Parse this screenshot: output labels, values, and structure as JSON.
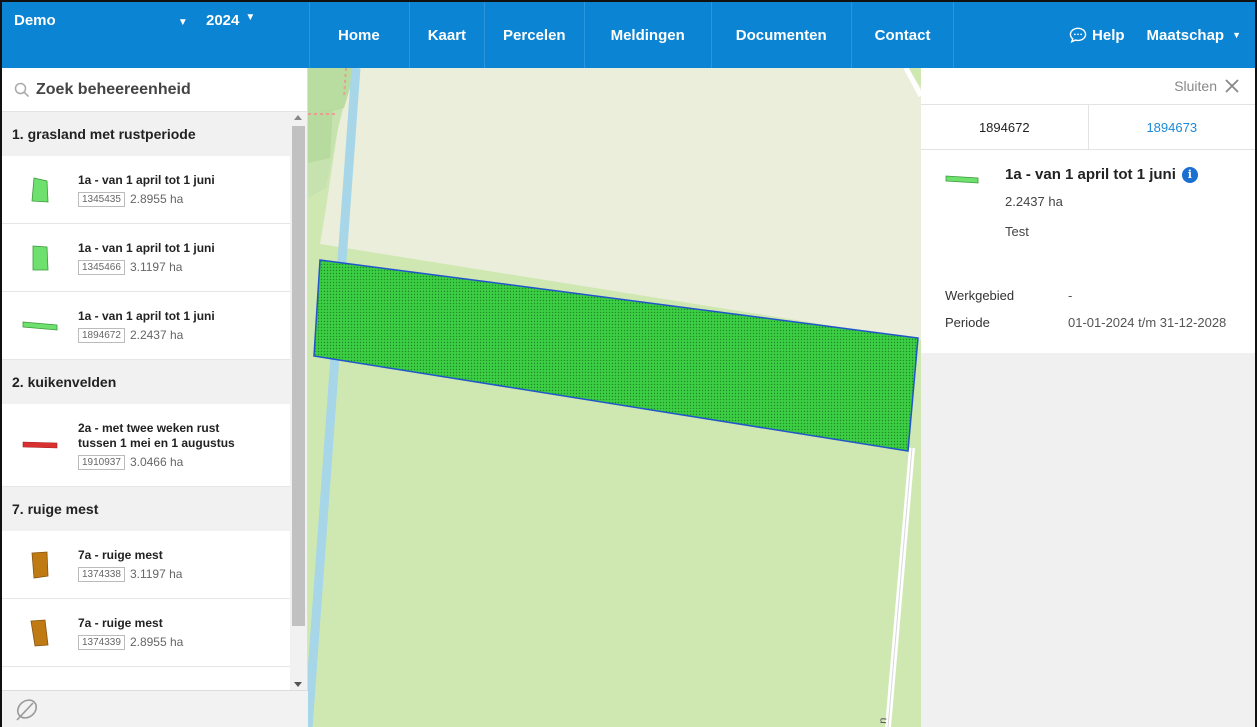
{
  "topbar": {
    "org": "Demo",
    "year": "2024",
    "nav": [
      "Home",
      "Kaart",
      "Percelen",
      "Meldingen",
      "Documenten",
      "Contact"
    ],
    "help": "Help",
    "account": "Maatschap"
  },
  "search": {
    "placeholder": "Zoek beheereenheid"
  },
  "groups": [
    {
      "title": "1. grasland met rustperiode",
      "items": [
        {
          "label": "1a - van 1 april tot 1 juni",
          "code": "1345435",
          "area": "2.8955 ha",
          "color": "#6ee06e"
        },
        {
          "label": "1a - van 1 april tot 1 juni",
          "code": "1345466",
          "area": "3.1197 ha",
          "color": "#6ee06e"
        },
        {
          "label": "1a - van 1 april tot 1 juni",
          "code": "1894672",
          "area": "2.2437 ha",
          "color": "#6ee06e"
        }
      ]
    },
    {
      "title": "2. kuikenvelden",
      "items": [
        {
          "label": "2a - met twee weken rust tussen 1 mei en 1 augustus",
          "code": "1910937",
          "area": "3.0466 ha",
          "color": "#d93030"
        }
      ]
    },
    {
      "title": "7. ruige mest",
      "items": [
        {
          "label": "7a - ruige mest",
          "code": "1374338",
          "area": "3.1197 ha",
          "color": "#c07a14"
        },
        {
          "label": "7a - ruige mest",
          "code": "1374339",
          "area": "2.8955 ha",
          "color": "#c07a14"
        }
      ]
    }
  ],
  "panel": {
    "close": "Sluiten",
    "tabs": [
      "1894672",
      "1894673"
    ],
    "title": "1a - van 1 april tot 1 juni",
    "area": "2.2437 ha",
    "note": "Test",
    "werkgebied_label": "Werkgebied",
    "werkgebied_value": "-",
    "periode_label": "Periode",
    "periode_value": "01-01-2024 t/m 31-12-2028"
  },
  "colors": {
    "brand": "#0b84d4",
    "parcel": "#35c43a",
    "parcel_border": "#2255cc"
  }
}
